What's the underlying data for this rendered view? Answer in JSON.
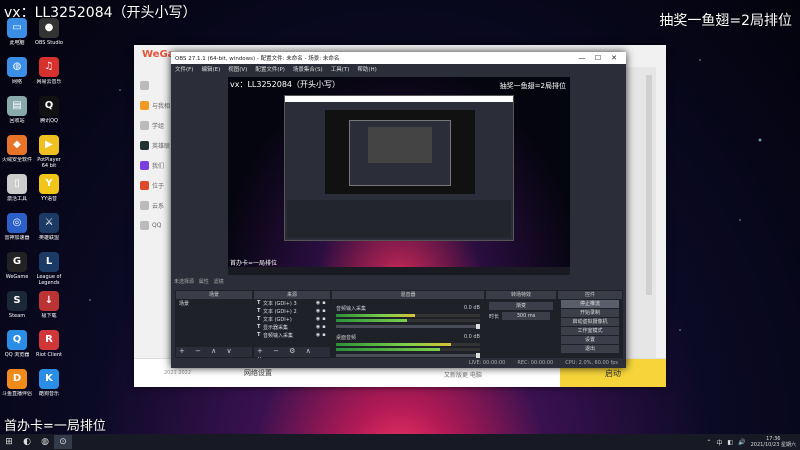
{
  "overlay": {
    "top_left": "vx：LL3252084（开头小写）",
    "top_right": "抽奖一鱼翅=2局排位",
    "bottom_left": "首办卡=一局排位"
  },
  "desktop_icons": [
    {
      "label": "此电脑",
      "color": "#3a8ee6",
      "glyph": "▭"
    },
    {
      "label": "OBS Studio",
      "color": "#333",
      "glyph": "●"
    },
    {
      "label": "网络",
      "color": "#3a8ee6",
      "glyph": "◍"
    },
    {
      "label": "网易云音乐",
      "color": "#d6312c",
      "glyph": "♫"
    },
    {
      "label": "回收站",
      "color": "#8aa",
      "glyph": "▤"
    },
    {
      "label": "腾讯QQ",
      "color": "#111",
      "glyph": "Q"
    },
    {
      "label": "火绒安全软件",
      "color": "#e8742a",
      "glyph": "◆"
    },
    {
      "label": "PotPlayer 64 bit",
      "color": "#f0c020",
      "glyph": "▶"
    },
    {
      "label": "激活工具",
      "color": "#ccc",
      "glyph": "▯"
    },
    {
      "label": "YY语音",
      "color": "#f2c618",
      "glyph": "Y"
    },
    {
      "label": "雷神加速器",
      "color": "#2a60c8",
      "glyph": "◎"
    },
    {
      "label": "英雄联盟",
      "color": "#1b3a66",
      "glyph": "⚔"
    },
    {
      "label": "WeGame",
      "color": "#222",
      "glyph": "G"
    },
    {
      "label": "League of Legends",
      "color": "#1b3a66",
      "glyph": "L"
    },
    {
      "label": "Steam",
      "color": "#1b2838",
      "glyph": "S"
    },
    {
      "label": "极下载",
      "color": "#b33",
      "glyph": "↓"
    },
    {
      "label": "QQ 浏览器",
      "color": "#2a8ee6",
      "glyph": "Q"
    },
    {
      "label": "Riot Client",
      "color": "#d13639",
      "glyph": "R"
    },
    {
      "label": "斗鱼直播伴侣",
      "color": "#f08a1a",
      "glyph": "D"
    },
    {
      "label": "酷狗音乐",
      "color": "#2a8ee6",
      "glyph": "K"
    }
  ],
  "launcher": {
    "logo": "WeGa",
    "side_items": [
      {
        "label": "",
        "color": "#bbb"
      },
      {
        "label": "与我相",
        "color": "#f29b22"
      },
      {
        "label": "学组",
        "color": "#bbb"
      },
      {
        "label": "英雄联",
        "color": "#233"
      },
      {
        "label": "我们",
        "color": "#7b3fe0"
      },
      {
        "label": "位于",
        "color": "#e04a2a"
      },
      {
        "label": "云系",
        "color": "#bbb"
      },
      {
        "label": "QQ",
        "color": "#bbb"
      }
    ],
    "version": "2021 2022",
    "network_settings": "网络设置",
    "update_notice": "又新版更 电脑",
    "launch_button": "启动"
  },
  "obs": {
    "title": "OBS 27.1.1 (64-bit, windows) - 配置文件: 未命名 - 场景: 未命名",
    "window_buttons": [
      "—",
      "☐",
      "✕"
    ],
    "menu": [
      "文件(F)",
      "编辑(E)",
      "视图(V)",
      "配置文件(P)",
      "场景集合(S)",
      "工具(T)",
      "帮助(H)"
    ],
    "preview": {
      "watermark_tl": "vx：LL3252084（开头小写）",
      "watermark_tr": "抽奖一鱼翅=2局排位",
      "watermark_bl": "首办卡=一局排位"
    },
    "toolbar_line": "未选择源",
    "toolbar_props": "属性",
    "toolbar_filters": "滤镜",
    "docks": {
      "scenes": {
        "header": "场景",
        "items": [
          "场景"
        ]
      },
      "sources": {
        "header": "来源",
        "items": [
          "文本 (GDI+) 3",
          "文本 (GDI+) 2",
          "文本 (GDI+)",
          "显示器采集",
          "音频输入采集"
        ]
      },
      "mixer": {
        "header": "混音器",
        "channels": [
          {
            "name": "音频输入采集",
            "db": "0.0 dB",
            "level": 0.55
          },
          {
            "name": "桌面音频",
            "db": "0.0 dB",
            "level": 0.8
          }
        ]
      },
      "transitions": {
        "header": "转场特效",
        "type": "渐变",
        "duration_label": "时长",
        "duration": "300 ms"
      },
      "controls": {
        "header": "控件",
        "buttons": [
          "停止推流",
          "开始录制",
          "启动虚拟摄像机",
          "工作室模式",
          "设置",
          "退出"
        ]
      }
    },
    "status": {
      "live": "LIVE: 00:00:00",
      "rec": "REC: 00:00:00",
      "cpu": "CPU: 2.0%, 60.00 fps"
    }
  },
  "taskbar": {
    "start": "⊞",
    "apps": [
      "◐",
      "◍",
      "⊙"
    ],
    "tray": [
      "⌃",
      "中",
      "◧",
      "🔊"
    ],
    "time": "17:36",
    "date": "2021/10/23 星期六"
  }
}
